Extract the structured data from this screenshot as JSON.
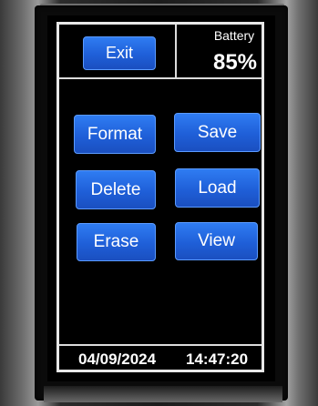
{
  "header": {
    "exit_label": "Exit",
    "battery_label": "Battery",
    "battery_value": "85%"
  },
  "buttons": [
    {
      "label": "Format"
    },
    {
      "label": "Save"
    },
    {
      "label": "Delete"
    },
    {
      "label": "Load"
    },
    {
      "label": "Erase"
    },
    {
      "label": "View"
    }
  ],
  "footer": {
    "date": "04/09/2024",
    "time": "14:47:20"
  },
  "colors": {
    "button_blue": "#1f5fd8",
    "frame_white": "#e8e8e8",
    "screen_black": "#000000"
  }
}
